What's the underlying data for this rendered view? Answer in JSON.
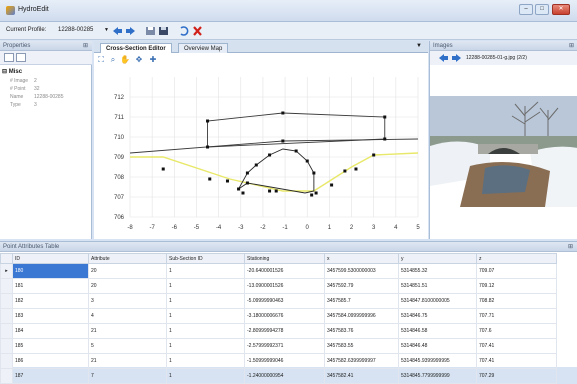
{
  "app": {
    "title": "HydroEdit"
  },
  "toolbar": {
    "profile_label": "Current Profile:",
    "profile_value": "12288-00285",
    "icons": [
      "back-arrow-icon",
      "forward-arrow-icon",
      "save-icon",
      "save-all-icon",
      "undo-icon",
      "delete-icon"
    ]
  },
  "properties": {
    "title": "Properties",
    "group": "Misc",
    "rows": [
      {
        "key": "# Image",
        "value": "2"
      },
      {
        "key": "# Point",
        "value": "32"
      },
      {
        "key": "Name",
        "value": "12288-00285"
      },
      {
        "key": "Type",
        "value": "3"
      }
    ]
  },
  "editor": {
    "tabs": [
      {
        "label": "Cross-Section Editor"
      },
      {
        "label": "Overview Map"
      }
    ]
  },
  "chart_data": {
    "type": "line",
    "title": "",
    "xlabel": "",
    "ylabel": "",
    "xlim": [
      -8,
      5
    ],
    "ylim": [
      706,
      713
    ],
    "x_ticks": [
      "-8",
      "-7",
      "-6",
      "-5",
      "-4",
      "-3",
      "-2",
      "-1",
      "0",
      "1",
      "2",
      "3",
      "4",
      "5"
    ],
    "y_ticks": [
      "706",
      "707",
      "708",
      "709",
      "710",
      "711",
      "712"
    ],
    "grid": true,
    "series": [
      {
        "name": "",
        "color": "#3a3a3a",
        "points": [
          [
            -4.5,
            709.5
          ],
          [
            3.5,
            709.9
          ],
          [
            3.5,
            711.0
          ],
          [
            -1.1,
            711.2
          ],
          [
            -4.5,
            710.8
          ],
          [
            -4.5,
            709.5
          ]
        ]
      },
      {
        "name": "",
        "color": "#3a3a3a",
        "points": [
          [
            -8,
            709.2
          ],
          [
            -1.1,
            709.8
          ],
          [
            5,
            709.9
          ]
        ]
      },
      {
        "name": "",
        "color": "#e8e86a",
        "points": [
          [
            -8,
            709.0
          ],
          [
            -6.5,
            709.0
          ],
          [
            -3.5,
            707.9
          ],
          [
            -1.1,
            707.3
          ],
          [
            0.3,
            707.3
          ],
          [
            2,
            708.5
          ],
          [
            3,
            709.1
          ],
          [
            5,
            709.2
          ]
        ]
      },
      {
        "name": "",
        "color": "#2a2a2a",
        "points": [
          [
            -3.1,
            707.4
          ],
          [
            -2.7,
            708.2
          ],
          [
            -2.3,
            708.6
          ],
          [
            -1.7,
            709.1
          ],
          [
            -1.1,
            709.4
          ],
          [
            -0.5,
            709.3
          ],
          [
            0,
            708.8
          ],
          [
            0.3,
            708.2
          ],
          [
            0.3,
            707.3
          ],
          [
            -0.1,
            707.2
          ],
          [
            -2.7,
            707.7
          ],
          [
            -3.1,
            707.4
          ]
        ]
      }
    ],
    "markers": [
      [
        -4.5,
        709.5
      ],
      [
        -4.5,
        710.8
      ],
      [
        -1.1,
        711.2
      ],
      [
        -1.1,
        709.8
      ],
      [
        3.5,
        711.0
      ],
      [
        3.5,
        709.9
      ],
      [
        -6.5,
        708.4
      ],
      [
        -4.4,
        707.9
      ],
      [
        -3.6,
        707.8
      ],
      [
        -3.1,
        707.4
      ],
      [
        -2.9,
        707.2
      ],
      [
        -2.7,
        707.7
      ],
      [
        -1.7,
        707.3
      ],
      [
        -1.4,
        707.3
      ],
      [
        0.2,
        707.1
      ],
      [
        0.4,
        707.2
      ],
      [
        1.1,
        707.6
      ],
      [
        1.7,
        708.3
      ],
      [
        2.2,
        708.4
      ],
      [
        3,
        709.1
      ],
      [
        -2.7,
        708.2
      ],
      [
        -2.3,
        708.6
      ],
      [
        -1.7,
        709.1
      ],
      [
        -0.5,
        709.3
      ],
      [
        0,
        708.8
      ],
      [
        0.3,
        708.2
      ]
    ]
  },
  "images_panel": {
    "title": "Images",
    "filename": "12288-00285-01-g.jpg (2/2)"
  },
  "table": {
    "title": "Point Attributes Table",
    "columns": [
      "ID",
      "Attribute",
      "Sub-Section ID",
      "Stationing",
      "x",
      "y",
      "z"
    ],
    "rows": [
      [
        "180",
        "20",
        "1",
        "-20.6400001526",
        "3457599.5300000003",
        "5314855.32",
        "709.07"
      ],
      [
        "181",
        "20",
        "1",
        "-13.0900001526",
        "3457592.79",
        "5314851.51",
        "709.12"
      ],
      [
        "182",
        "3",
        "1",
        "-5.09999990463",
        "3457585.7",
        "5314847.8100000005",
        "708.82"
      ],
      [
        "183",
        "4",
        "1",
        "-3.18000006676",
        "3457584.0999999996",
        "5314846.75",
        "707.71"
      ],
      [
        "184",
        "21",
        "1",
        "-2.80999994278",
        "3457583.76",
        "5314846.58",
        "707.6"
      ],
      [
        "185",
        "5",
        "1",
        "-2.57999992371",
        "3457583.55",
        "5314846.48",
        "707.41"
      ],
      [
        "186",
        "21",
        "1",
        "-1.50999999046",
        "3457582.6399999997",
        "5314845.9399999995",
        "707.41"
      ],
      [
        "187",
        "7",
        "1",
        "-1.24000000954",
        "3457582.41",
        "5314845.7799999999",
        "707.29"
      ]
    ]
  }
}
